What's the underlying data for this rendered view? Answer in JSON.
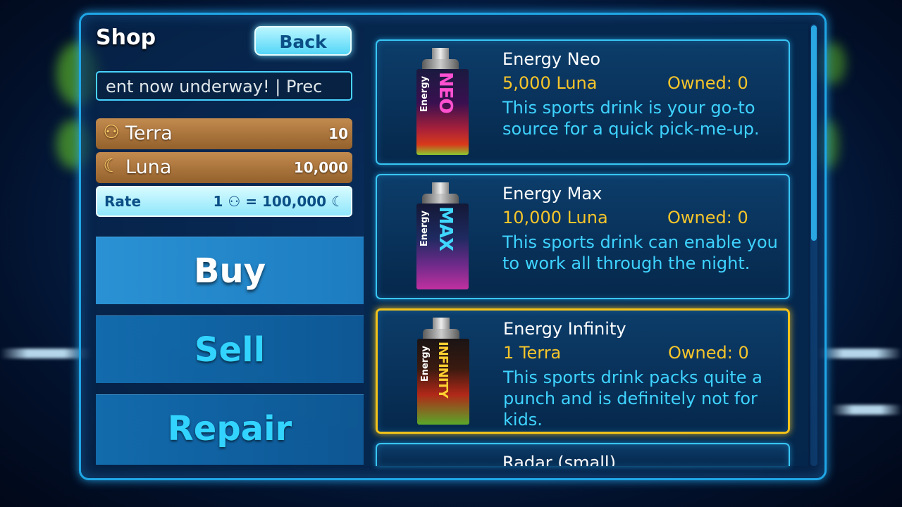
{
  "screen": {
    "title": "Shop",
    "back_label": "Back",
    "ticker_text": "ent now underway! | Prec"
  },
  "wallet": {
    "terra_label": "Terra",
    "terra_value": "10",
    "luna_label": "Luna",
    "luna_value": "10,000",
    "rate_label": "Rate",
    "rate_value": "1 ⚇ = 100,000 ☾"
  },
  "menu": {
    "buy_label": "Buy",
    "sell_label": "Sell",
    "repair_label": "Repair"
  },
  "items": [
    {
      "name": "Energy Neo",
      "price": "5,000 Luna",
      "owned": "Owned: 0",
      "description": "This sports drink is your go-to source for a quick pick-me-up.",
      "can_side": "Energy",
      "can_big": "NEO"
    },
    {
      "name": "Energy Max",
      "price": "10,000 Luna",
      "owned": "Owned: 0",
      "description": "This sports drink can enable you to work all through the night.",
      "can_side": "Energy",
      "can_big": "MAX"
    },
    {
      "name": "Energy Infinity",
      "price": "1 Terra",
      "owned": "Owned: 0",
      "description": "This sports drink packs quite a punch and is definitely not for kids.",
      "can_side": "Energy",
      "can_big": "INFINITY"
    },
    {
      "name": "Radar (small)"
    }
  ],
  "selected_item_index": 2,
  "colors": {
    "accent_cyan": "#32d4ff",
    "price_gold": "#f7c52a",
    "selection_gold": "#f2c21a",
    "currency_bronze": "#b07a40"
  }
}
